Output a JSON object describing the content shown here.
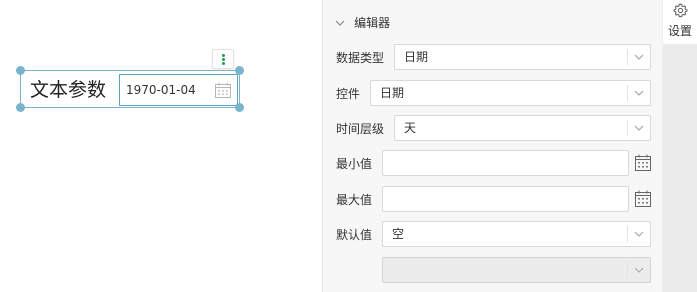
{
  "canvas": {
    "widget": {
      "label": "文本参数",
      "date_value": "1970-01-04"
    },
    "more_button_icon": "more-vertical-icon"
  },
  "editor": {
    "title": "编辑器",
    "fields": {
      "data_type": {
        "label": "数据类型",
        "value": "日期"
      },
      "control": {
        "label": "控件",
        "value": "日期"
      },
      "time_level": {
        "label": "时间层级",
        "value": "天"
      },
      "min_value": {
        "label": "最小值",
        "value": ""
      },
      "max_value": {
        "label": "最大值",
        "value": ""
      },
      "default_value": {
        "label": "默认值",
        "value": "空"
      },
      "extra_select": {
        "value": ""
      }
    }
  },
  "sidebar": {
    "settings_label": "设置",
    "settings_icon": "gear-icon"
  },
  "colors": {
    "selection_border": "#7fb2c8",
    "handle": "#78b4cc",
    "more_dots": "#1fa04b",
    "panel_bg": "#f7f7f7"
  }
}
